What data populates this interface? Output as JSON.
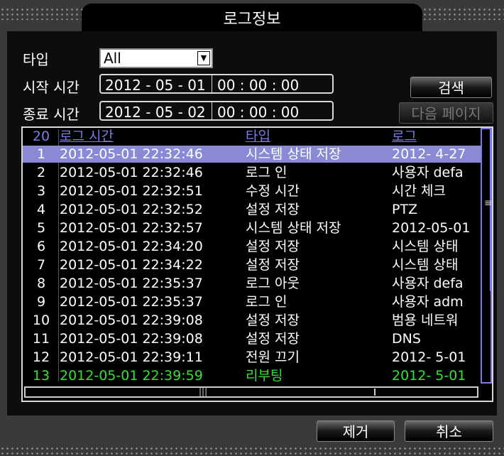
{
  "window": {
    "title": "로그정보"
  },
  "filters": {
    "type_label": "타입",
    "type_value": "All",
    "start_label": "시작 시간",
    "start_date": "2012 - 05 - 01",
    "start_time": "00 : 00 : 00",
    "end_label": "종료 시간",
    "end_date": "2012 - 05 - 02",
    "end_time": "00 : 00 : 00"
  },
  "buttons": {
    "search": "검색",
    "next_page": "다음 페이지",
    "remove": "제거",
    "cancel": "취소"
  },
  "table": {
    "headers": {
      "count": "20",
      "time": "로그 시간",
      "type": "타입",
      "log": "로그"
    },
    "rows": [
      {
        "no": "1",
        "time": "2012-05-01 22:32:46",
        "type": "시스템 상태 저장",
        "log": "2012- 4-27"
      },
      {
        "no": "2",
        "time": "2012-05-01 22:32:46",
        "type": "로그 인",
        "log": "사용자 defa"
      },
      {
        "no": "3",
        "time": "2012-05-01 22:32:51",
        "type": "수정 시간",
        "log": "시간 체크"
      },
      {
        "no": "4",
        "time": "2012-05-01 22:32:52",
        "type": "설정 저장",
        "log": "PTZ"
      },
      {
        "no": "5",
        "time": "2012-05-01 22:32:57",
        "type": "시스템 상태 저장",
        "log": "2012-05-01"
      },
      {
        "no": "6",
        "time": "2012-05-01 22:34:20",
        "type": "설정 저장",
        "log": "시스템 상태"
      },
      {
        "no": "7",
        "time": "2012-05-01 22:34:22",
        "type": "설정 저장",
        "log": "시스템 상태"
      },
      {
        "no": "8",
        "time": "2012-05-01 22:35:37",
        "type": "로그 아웃",
        "log": "사용자 defa"
      },
      {
        "no": "9",
        "time": "2012-05-01 22:35:37",
        "type": "로그 인",
        "log": "사용자 adm"
      },
      {
        "no": "10",
        "time": "2012-05-01 22:39:08",
        "type": "설정 저장",
        "log": "범용 네트워"
      },
      {
        "no": "11",
        "time": "2012-05-01 22:39:08",
        "type": "설정 저장",
        "log": "DNS"
      },
      {
        "no": "12",
        "time": "2012-05-01 22:39:11",
        "type": "전원 끄기",
        "log": "2012- 5-01"
      },
      {
        "no": "13",
        "time": "2012-05-01 22:39:59",
        "type": "리부팅",
        "log": "2012- 5-01"
      }
    ]
  },
  "colors": {
    "selected_row": "#8a89d6",
    "header_text": "#7a7ae8",
    "highlight_row_text": "#33e233"
  }
}
